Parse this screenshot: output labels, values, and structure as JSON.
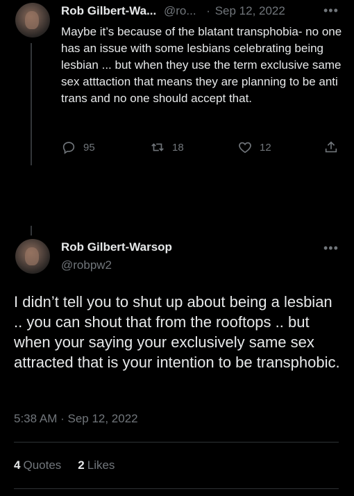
{
  "tweet1": {
    "name": "Rob Gilbert-Wa...",
    "handle": "@ro...",
    "separator": "·",
    "date": "Sep 12, 2022",
    "more_icon": "more-dots-icon",
    "text": "Maybe it’s because of the blatant transphobia- no one has an issue with some lesbians celebrating being lesbian ... but when they use the term exclusive same sex atttaction that means they are planning to be anti trans and no one should accept that.",
    "replies": "95",
    "retweets": "18",
    "likes": "12"
  },
  "tweet2": {
    "name": "Rob Gilbert-Warsop",
    "handle": "@robpw2",
    "text": "I didn’t tell you to shut up about being a lesbian .. you can shout that from the rooftops .. but when your saying your exclusively same sex attracted that is your intention to be transphobic.",
    "timestamp": "5:38 AM · Sep 12, 2022",
    "quotes_count": "4",
    "quotes_label": "Quotes",
    "likes_count": "2",
    "likes_label": "Likes"
  },
  "colors": {
    "background": "#000000",
    "text": "#e7e9ea",
    "muted": "#71767b",
    "divider": "#2f3336"
  }
}
